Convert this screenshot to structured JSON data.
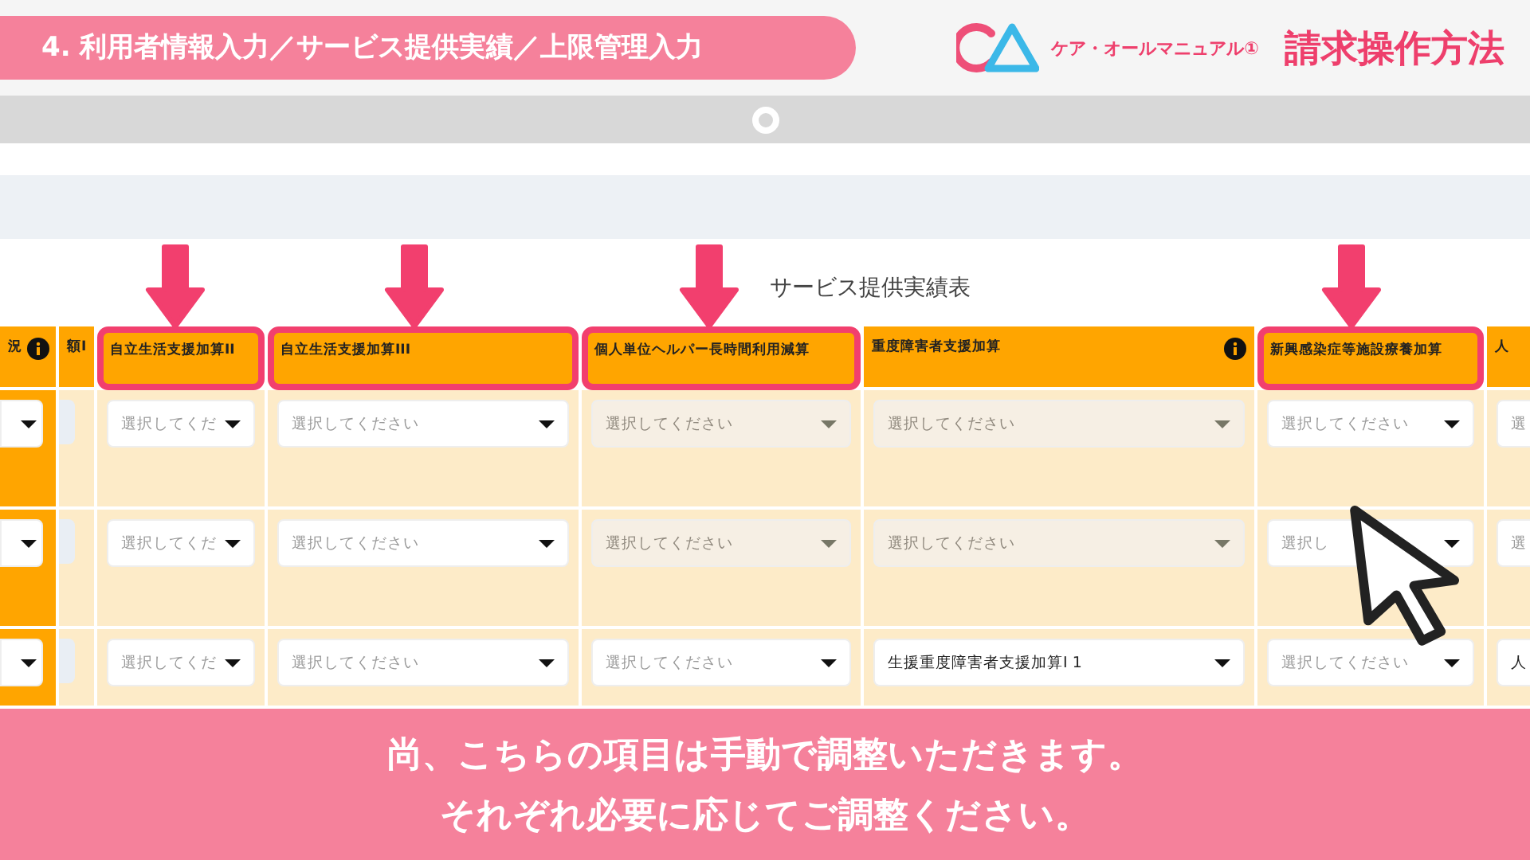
{
  "header": {
    "section": "4.  利用者情報入力／サービス提供実績／上限管理入力",
    "manual": "ケア・オールマニュアル①",
    "title": "請求操作方法"
  },
  "table": {
    "title": "サービス提供実績表",
    "columns": [
      {
        "label": "況",
        "info": true,
        "highlighted": false,
        "arrow": false,
        "kind": "stub"
      },
      {
        "label": "額I",
        "info": false,
        "highlighted": false,
        "arrow": false,
        "kind": "blank"
      },
      {
        "label": "自立生活支援加算II",
        "info": false,
        "highlighted": true,
        "arrow": true,
        "kind": "select"
      },
      {
        "label": "自立生活支援加算III",
        "info": false,
        "highlighted": true,
        "arrow": true,
        "kind": "select"
      },
      {
        "label": "個人単位ヘルパー長時間利用減算",
        "info": false,
        "highlighted": true,
        "arrow": true,
        "kind": "select"
      },
      {
        "label": "重度障害者支援加算",
        "info": true,
        "highlighted": false,
        "arrow": false,
        "kind": "select"
      },
      {
        "label": "新興感染症等施設療養加算",
        "info": false,
        "highlighted": true,
        "arrow": true,
        "kind": "select"
      },
      {
        "label": "人",
        "info": false,
        "highlighted": false,
        "arrow": false,
        "kind": "select"
      }
    ],
    "rows": [
      {
        "cells": [
          {},
          {},
          {
            "placeholder": "選択してくだ",
            "disabled": false
          },
          {
            "placeholder": "選択してください",
            "disabled": false
          },
          {
            "placeholder": "選択してください",
            "disabled": true
          },
          {
            "placeholder": "選択してください",
            "disabled": true
          },
          {
            "placeholder": "選択してください",
            "disabled": false
          },
          {
            "placeholder": "選",
            "disabled": false
          }
        ]
      },
      {
        "cells": [
          {},
          {},
          {
            "placeholder": "選択してくだ",
            "disabled": false
          },
          {
            "placeholder": "選択してください",
            "disabled": false
          },
          {
            "placeholder": "選択してください",
            "disabled": true
          },
          {
            "placeholder": "選択してください",
            "disabled": true
          },
          {
            "placeholder": "選択し",
            "disabled": false
          },
          {
            "placeholder": "選",
            "disabled": false
          }
        ]
      },
      {
        "cells": [
          {},
          {},
          {
            "placeholder": "選択してくだ",
            "disabled": false
          },
          {
            "placeholder": "選択してください",
            "disabled": false
          },
          {
            "placeholder": "選択してください",
            "disabled": false
          },
          {
            "value": "生援重度障害者支援加算I 1",
            "disabled": false
          },
          {
            "placeholder": "選択してください",
            "disabled": false
          },
          {
            "value": "人",
            "disabled": false
          }
        ]
      }
    ]
  },
  "caption": [
    "尚、こちらの項目は手動で調整いただきます。",
    "それぞれ必要に応じてご調整ください。"
  ]
}
